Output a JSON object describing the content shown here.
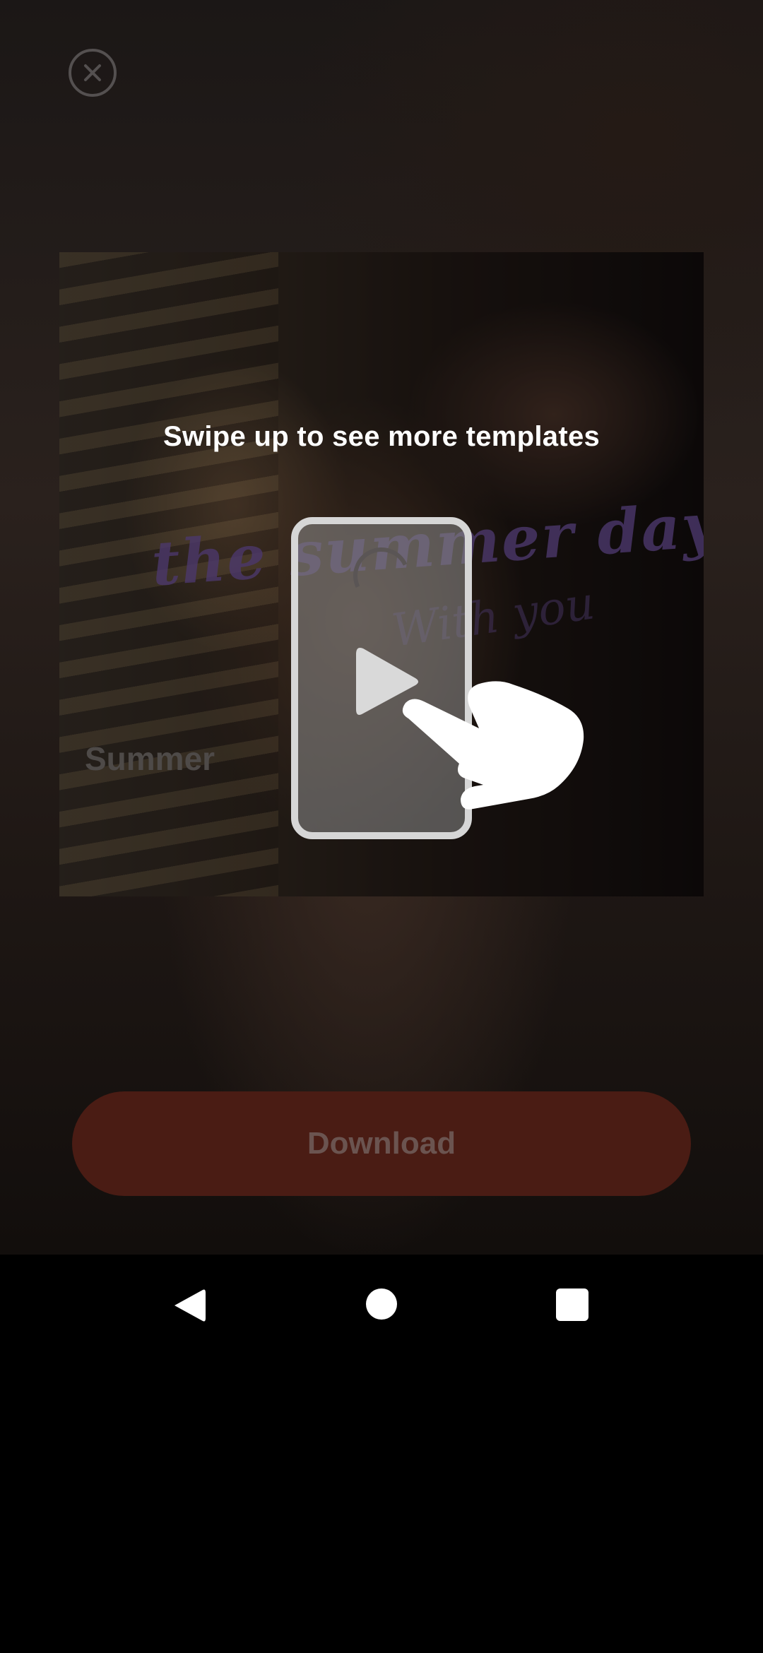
{
  "overlay": {
    "hint_text": "Swipe up to see more templates"
  },
  "template": {
    "name": "Summer",
    "overlay_title": "the summer day",
    "overlay_subtitle": "With you"
  },
  "actions": {
    "download_label": "Download"
  },
  "icons": {
    "close": "close-circle-icon",
    "play": "play-icon",
    "hand": "swipe-hand-icon",
    "back": "nav-back-icon",
    "home": "nav-home-icon",
    "recents": "nav-recents-icon"
  },
  "colors": {
    "download_button": "#4a1c14",
    "download_text": "#6b5450",
    "hint_text": "#ffffff",
    "neon_text": "#8a66c4"
  }
}
